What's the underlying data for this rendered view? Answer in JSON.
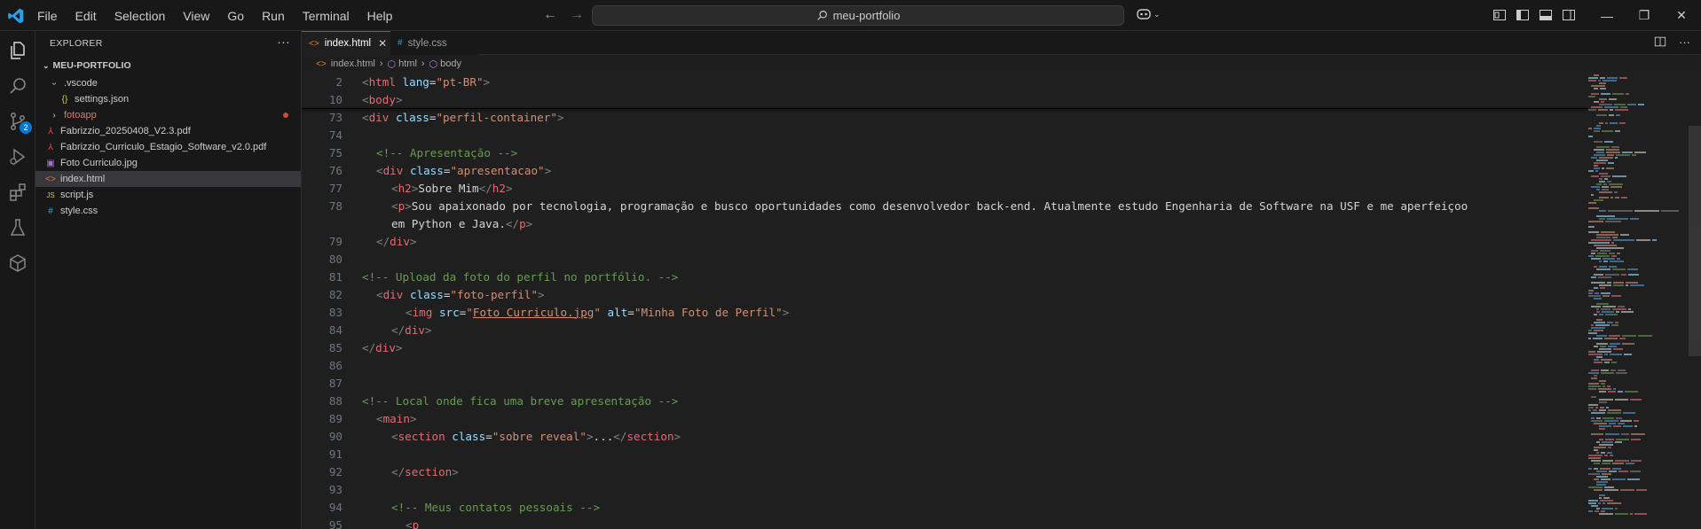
{
  "menu": [
    "File",
    "Edit",
    "Selection",
    "View",
    "Go",
    "Run",
    "Terminal",
    "Help"
  ],
  "search": {
    "text": "meu-portfolio"
  },
  "window_controls": {
    "minimize": "—",
    "restore": "❐",
    "close": "✕"
  },
  "explorer": {
    "title": "EXPLORER",
    "more": "···",
    "section": "MEU-PORTFOLIO",
    "items": [
      {
        "label": ".vscode",
        "icon": "›",
        "type": "folder-open"
      },
      {
        "label": "settings.json",
        "icon": "{}",
        "type": "json"
      },
      {
        "label": "fotoapp",
        "icon": "›",
        "type": "folder"
      },
      {
        "label": "Fabrizzio_20250408_V2.3.pdf",
        "icon": "pdf",
        "type": "pdf"
      },
      {
        "label": "Fabrizzio_Curriculo_Estagio_Software_v2.0.pdf",
        "icon": "pdf",
        "type": "pdf"
      },
      {
        "label": "Foto Curriculo.jpg",
        "icon": "img",
        "type": "image"
      },
      {
        "label": "index.html",
        "icon": "<>",
        "type": "html"
      },
      {
        "label": "script.js",
        "icon": "JS",
        "type": "js"
      },
      {
        "label": "style.css",
        "icon": "#",
        "type": "css"
      }
    ]
  },
  "tabs": [
    {
      "label": "index.html",
      "icon": "<>",
      "close": "✕"
    },
    {
      "label": "style.css",
      "icon": "#"
    }
  ],
  "breadcrumb": {
    "file": "index.html",
    "html": "html",
    "body": "body"
  },
  "scm_badge": "2",
  "editor": {
    "lines": [
      {
        "n": "2"
      },
      {
        "n": "10"
      },
      {
        "n": "73"
      },
      {
        "n": "74"
      },
      {
        "n": "75"
      },
      {
        "n": "76"
      },
      {
        "n": "77"
      },
      {
        "n": "78"
      },
      {
        "n": ""
      },
      {
        "n": "79"
      },
      {
        "n": "80"
      },
      {
        "n": "81"
      },
      {
        "n": "82"
      },
      {
        "n": "83"
      },
      {
        "n": "84"
      },
      {
        "n": "85"
      },
      {
        "n": "86"
      },
      {
        "n": "87"
      },
      {
        "n": "88"
      },
      {
        "n": "89"
      },
      {
        "n": "90"
      },
      {
        "n": "91"
      },
      {
        "n": "92"
      },
      {
        "n": "93"
      },
      {
        "n": "94"
      },
      {
        "n": "95"
      }
    ],
    "text": {
      "l2_lang": "\"pt-BR\"",
      "l73_class": "\"perfil-container\"",
      "l75": "<!-- Apresentação -->",
      "l76_class": "\"apresentacao\"",
      "l77_text": "Sobre Mim",
      "l78_text": "Sou apaixonado por tecnologia, programação e busco oportunidades como desenvolvedor back-end. Atualmente estudo Engenharia de Software na USF e me aperfeiçoo",
      "l78b_text": "em Python e Java.",
      "l81": "<!-- Upload da foto do perfil no portfólio. -->",
      "l82_class": "\"foto-perfil\"",
      "l83_src": "Foto Curriculo.jpg",
      "l83_alt": "\"Minha Foto de Perfil\"",
      "l88": "<!-- Local onde fica uma breve apresentação -->",
      "l90_class": "\"sobre reveal\"",
      "l90_fold": "...",
      "l94": "<!-- Meus contatos pessoais -->"
    }
  },
  "colors": {
    "accent": "#0078d4",
    "editor_bg": "#1f1f1f",
    "sidebar_bg": "#181818"
  }
}
